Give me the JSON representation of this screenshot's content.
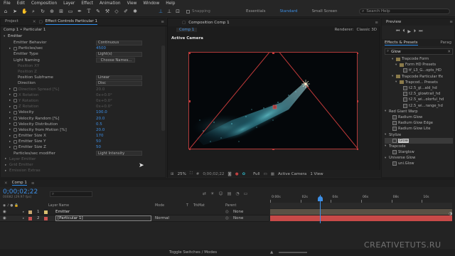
{
  "menu": [
    "File",
    "Edit",
    "Composition",
    "Layer",
    "Effect",
    "Animation",
    "View",
    "Window",
    "Help"
  ],
  "toolbar": {
    "snapping": "Snapping",
    "workspaces": [
      "Essentials",
      "Standard",
      "Small Screen"
    ],
    "active_workspace": "Standard",
    "search_placeholder": "Search Help"
  },
  "left_panel": {
    "tabs": [
      "Project",
      "Effect Controls Particular 1"
    ],
    "breadcrumb": "Comp 1 • Particular 1",
    "effect_name": "Emitter",
    "properties": [
      {
        "label": "Emitter Behavior",
        "value": "Continuous",
        "kind": "dd",
        "indent": 1
      },
      {
        "label": "Particles/sec",
        "value": "4500",
        "kind": "num",
        "indent": 1,
        "tw": true
      },
      {
        "label": "Emitter Type",
        "value": "Light(s)",
        "kind": "dd",
        "indent": 1
      },
      {
        "label": "Light Naming",
        "value": "Choose Names...",
        "kind": "btn",
        "indent": 1
      },
      {
        "label": "Position XY",
        "value": "",
        "kind": "dim",
        "indent": 2
      },
      {
        "label": "Position Z",
        "value": "",
        "kind": "dim",
        "indent": 2
      },
      {
        "label": "Position Subframe",
        "value": "Linear",
        "kind": "dd",
        "indent": 2
      },
      {
        "label": "Direction",
        "value": "Disc",
        "kind": "dd",
        "indent": 2
      },
      {
        "label": "Direction Spread [%]",
        "value": "20.0",
        "kind": "dimv",
        "indent": 1,
        "tw": true
      },
      {
        "label": "X Rotation",
        "value": "0x+0.0°",
        "kind": "dimv",
        "indent": 1,
        "tw": true
      },
      {
        "label": "Y Rotation",
        "value": "0x+0.0°",
        "kind": "dimv",
        "indent": 1,
        "tw": true
      },
      {
        "label": "Z Rotation",
        "value": "0x+0.0°",
        "kind": "dimv",
        "indent": 1,
        "tw": true
      },
      {
        "label": "Velocity",
        "value": "100.0",
        "kind": "num",
        "indent": 1,
        "tw": true
      },
      {
        "label": "Velocity Random [%]",
        "value": "20.0",
        "kind": "num",
        "indent": 1,
        "tw": true
      },
      {
        "label": "Velocity Distribution",
        "value": "0.5",
        "kind": "num",
        "indent": 1,
        "tw": true
      },
      {
        "label": "Velocity from Motion [%]",
        "value": "20.0",
        "kind": "num",
        "indent": 1,
        "tw": true
      },
      {
        "label": "Emitter Size X",
        "value": "170",
        "kind": "num",
        "indent": 1,
        "tw": true
      },
      {
        "label": "Emitter Size Y",
        "value": "50",
        "kind": "num",
        "indent": 1,
        "tw": true
      },
      {
        "label": "Emitter Size Z",
        "value": "50",
        "kind": "num",
        "indent": 1,
        "tw": true
      },
      {
        "label": "Particles/sec modifier",
        "value": "Light Intensity",
        "kind": "dd",
        "indent": 1
      },
      {
        "label": "Layer Emitter",
        "value": "",
        "kind": "dimsec",
        "indent": 0
      },
      {
        "label": "Grid Emitter",
        "value": "",
        "kind": "dimsec",
        "indent": 0
      },
      {
        "label": "Emission Extras",
        "value": "",
        "kind": "dimsec",
        "indent": 0
      }
    ]
  },
  "comp_panel": {
    "tab_title": "Composition Comp 1",
    "subtab": "Comp 1",
    "renderer_label": "Renderer:",
    "renderer": "Classic 3D",
    "camera_label": "Active Camera",
    "zoom": "25%",
    "timecode": "0;00;02;22",
    "resolution": "Full",
    "camera_dd": "Active Camera",
    "view_dd": "1 View"
  },
  "right_panel": {
    "preview_label": "Preview",
    "effects_tab": "Effects & Presets",
    "para_tab": "Parag",
    "search_value": "Glow",
    "tree": [
      {
        "label": "Trapcode Form",
        "level": 2,
        "type": "folder",
        "tri": "▾"
      },
      {
        "label": "Form HD Presets",
        "level": 3,
        "type": "folder",
        "tri": "▾"
      },
      {
        "label": "tf_L3_G...opts_HD",
        "level": 4,
        "type": "preset",
        "tri": ""
      },
      {
        "label": "Trapcode Particular ffx",
        "level": 2,
        "type": "folder",
        "tri": "▾"
      },
      {
        "label": "Trapcod... Presets",
        "level": 3,
        "type": "folder",
        "tri": "▾"
      },
      {
        "label": "t2.5_gl...ald_hd",
        "level": 4,
        "type": "preset",
        "tri": ""
      },
      {
        "label": "t2.5_glowtrail_hd",
        "level": 4,
        "type": "preset",
        "tri": ""
      },
      {
        "label": "t2.5_wi...olorful_hd",
        "level": 4,
        "type": "preset",
        "tri": ""
      },
      {
        "label": "t2.5_wi...range_hd",
        "level": 4,
        "type": "preset",
        "tri": ""
      },
      {
        "label": "Red Giant Warp",
        "level": 0,
        "type": "cat",
        "tri": "▾"
      },
      {
        "label": "Radium Glow",
        "level": 1,
        "type": "effect",
        "tri": ""
      },
      {
        "label": "Radium Glow Edge",
        "level": 1,
        "type": "effect",
        "tri": ""
      },
      {
        "label": "Radium Glow Lite",
        "level": 1,
        "type": "effect",
        "tri": ""
      },
      {
        "label": "Stylize",
        "level": 0,
        "type": "cat",
        "tri": "▾"
      },
      {
        "label": "Glow",
        "level": 1,
        "type": "effect-sel",
        "tri": ""
      },
      {
        "label": "Trapcode",
        "level": 0,
        "type": "cat",
        "tri": "▾"
      },
      {
        "label": "Starglow",
        "level": 1,
        "type": "effect",
        "tri": ""
      },
      {
        "label": "Universe Glow",
        "level": 0,
        "type": "cat",
        "tri": "▾"
      },
      {
        "label": "uni.Glow",
        "level": 1,
        "type": "effect",
        "tri": ""
      }
    ]
  },
  "timeline": {
    "tab": "Comp 1",
    "timecode": "0;00;02;22",
    "frame_info": "00082 (29.97 fps)",
    "col_layer": "Layer Name",
    "col_mode": "Mode",
    "col_t": "T",
    "col_trkmat": "TrkMat",
    "col_parent": "Parent",
    "layers": [
      {
        "num": "1",
        "name": "Emitter",
        "mode": "",
        "parent": "None",
        "color": "#c9a870"
      },
      {
        "num": "2",
        "name": "[Particular 1]",
        "mode": "Normal",
        "parent": "None",
        "color": "#c85050"
      }
    ],
    "ruler": [
      "0:00s",
      "02s",
      "04s",
      "06s",
      "08s",
      "10s"
    ],
    "toggle_label": "Toggle Switches / Modes"
  },
  "watermark": "CREATIVETUTS.RU"
}
